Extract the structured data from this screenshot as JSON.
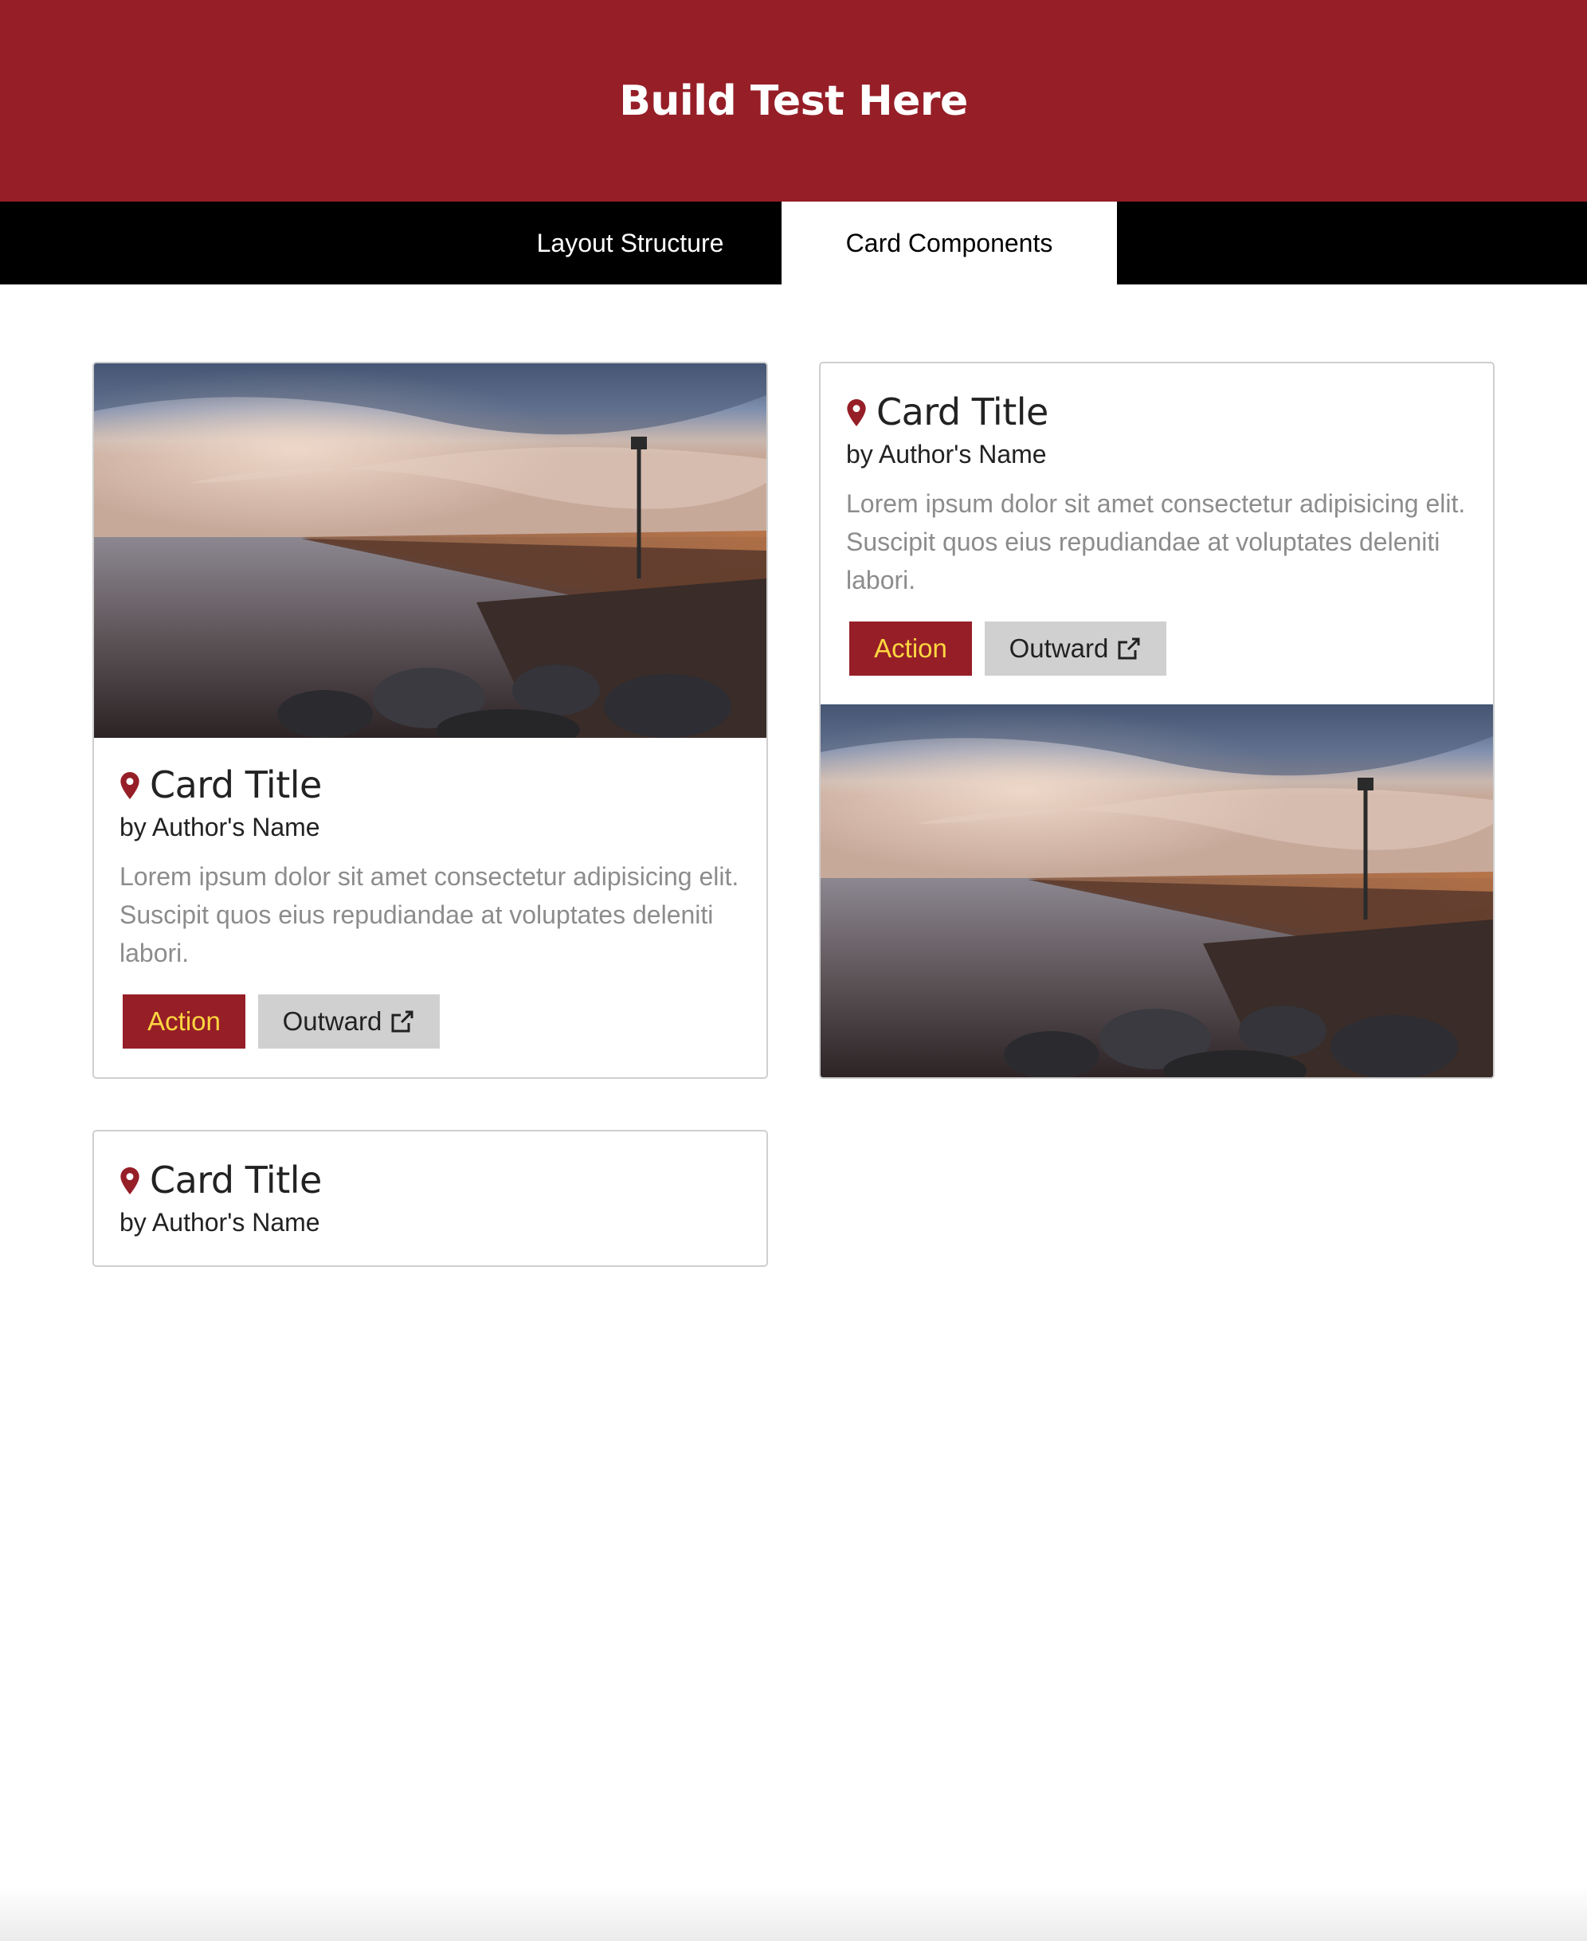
{
  "header": {
    "title": "Build Test Here"
  },
  "nav": {
    "tabs": [
      {
        "label": "Layout Structure",
        "active": false
      },
      {
        "label": "Card Components",
        "active": true
      }
    ]
  },
  "colors": {
    "brand": "#961e27",
    "action_text": "#ffd740",
    "secondary_button": "#d0d0d0",
    "nav_background": "#000000",
    "description_text": "#8c8c8c"
  },
  "cards": [
    {
      "icon": "map-pin-icon",
      "title": "Card Title",
      "author": "by Author's Name",
      "description": "Lorem ipsum dolor sit amet consectetur adipisicing elit. Suscipit quos eius repudiandae at voluptates deleniti labori.",
      "action_label": "Action",
      "outward_label": "Outward",
      "outward_icon": "external-link-icon",
      "image": "pier-at-sunset"
    },
    {
      "icon": "map-pin-icon",
      "title": "Card Title",
      "author": "by Author's Name",
      "description": "Lorem ipsum dolor sit amet consectetur adipisicing elit. Suscipit quos eius repudiandae at voluptates deleniti labori.",
      "action_label": "Action",
      "outward_label": "Outward",
      "outward_icon": "external-link-icon",
      "image": "pier-at-sunset"
    },
    {
      "icon": "map-pin-icon",
      "title": "Card Title",
      "author": "by Author's Name"
    }
  ]
}
